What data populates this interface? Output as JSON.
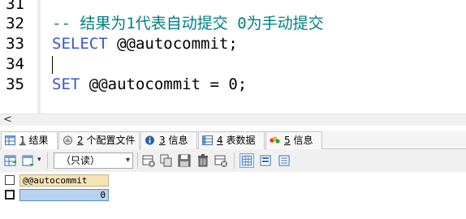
{
  "editor": {
    "lines": [
      {
        "number": "31",
        "text": ""
      },
      {
        "number": "32",
        "text": "-- 结果为1代表自动提交 0为手动提交"
      },
      {
        "number": "33",
        "keyword": "SELECT",
        "rest": " @@autocommit;"
      },
      {
        "number": "34",
        "text": ""
      },
      {
        "number": "35",
        "keyword": "SET",
        "rest": " @@autocommit = 0;"
      }
    ]
  },
  "hscroll": {
    "left_arrow": "<"
  },
  "tabs": [
    {
      "num": "1",
      "label": " 结果",
      "icon": "grid-icon"
    },
    {
      "num": "2",
      "label": " 个配置文件",
      "icon": "profile-icon"
    },
    {
      "num": "3",
      "label": " 信息",
      "icon": "info-icon"
    },
    {
      "num": "4",
      "label": " 表数据",
      "icon": "table-data-icon"
    },
    {
      "num": "5",
      "label": " 信息",
      "icon": "info-color-icon"
    }
  ],
  "toolbar": {
    "mode_select": "（只读）"
  },
  "grid": {
    "columns": [
      "@@autocommit"
    ],
    "rows": [
      [
        "0"
      ]
    ]
  },
  "colors": {
    "comment": "#008080",
    "keyword": "#3a56c8",
    "header_cell": "#f5e3b3",
    "selected_cell": "#b9d2ee"
  }
}
